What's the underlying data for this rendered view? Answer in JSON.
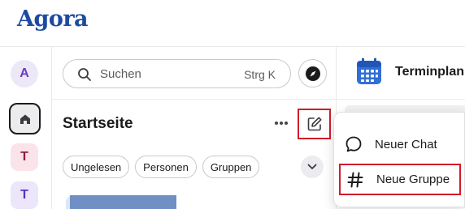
{
  "app": {
    "logo_text": "Agora",
    "brand_color": "#1c4aa0"
  },
  "rail": {
    "items": [
      {
        "label": "A",
        "icon": "avatar-a"
      },
      {
        "label": "",
        "icon": "home-icon",
        "selected": true
      },
      {
        "label": "T",
        "icon": "avatar-t"
      },
      {
        "label": "T",
        "icon": "avatar-t"
      }
    ]
  },
  "search": {
    "placeholder": "Suchen",
    "shortcut": "Strg K"
  },
  "home": {
    "title": "Startseite",
    "filters": [
      "Ungelesen",
      "Personen",
      "Gruppen"
    ]
  },
  "right_panel": {
    "title": "Terminplan"
  },
  "new_menu": {
    "items": [
      {
        "label": "Neuer Chat",
        "icon": "chat-bubble-icon"
      },
      {
        "label": "Neue Gruppe",
        "icon": "hash-icon",
        "highlighted": true
      }
    ]
  },
  "highlight_color": "#d11c2a"
}
